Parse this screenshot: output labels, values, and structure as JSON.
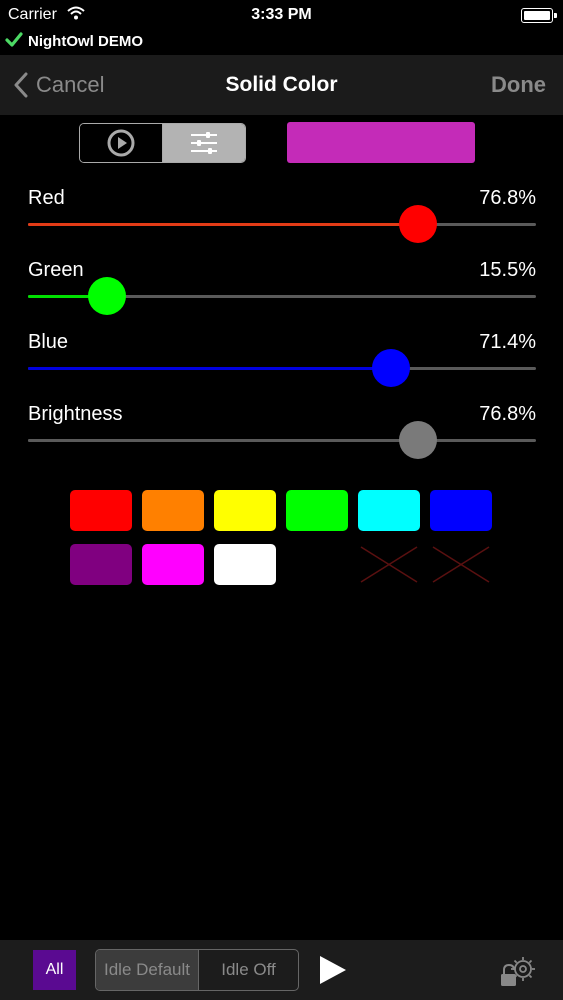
{
  "status_bar": {
    "carrier": "Carrier",
    "time": "3:33 PM"
  },
  "device": {
    "name": "NightOwl DEMO",
    "status_icon": "check-icon",
    "status_color": "#4cd964"
  },
  "nav": {
    "cancel_label": "Cancel",
    "title": "Solid Color",
    "done_label": "Done"
  },
  "mode_segment": {
    "items": [
      "play-circle-icon",
      "sliders-icon"
    ],
    "selected": 0
  },
  "preview": {
    "color": "#c42bb8"
  },
  "sliders": [
    {
      "label": "Red",
      "value_text": "76.8%",
      "value": 0.768,
      "color": "#ff0000",
      "fill": "#e33b16"
    },
    {
      "label": "Green",
      "value_text": "15.5%",
      "value": 0.155,
      "color": "#00ff00",
      "fill": "#00e000"
    },
    {
      "label": "Blue",
      "value_text": "71.4%",
      "value": 0.714,
      "color": "#0000ff",
      "fill": "#0000e0"
    },
    {
      "label": "Brightness",
      "value_text": "76.8%",
      "value": 0.768,
      "color": "#7a7a7a",
      "fill": "#5a5a5a"
    }
  ],
  "swatches": [
    {
      "color": "#ff0000"
    },
    {
      "color": "#ff8000"
    },
    {
      "color": "#ffff00"
    },
    {
      "color": "#00ff00"
    },
    {
      "color": "#00ffff"
    },
    {
      "color": "#0000ff"
    },
    {
      "color": "#800080"
    },
    {
      "color": "#ff00ff"
    },
    {
      "color": "#ffffff"
    },
    {
      "color": null
    },
    {
      "color": null
    },
    {
      "color": null
    }
  ],
  "toolbar": {
    "all_label": "All",
    "idle_default_label": "Idle Default",
    "idle_off_label": "Idle Off"
  }
}
